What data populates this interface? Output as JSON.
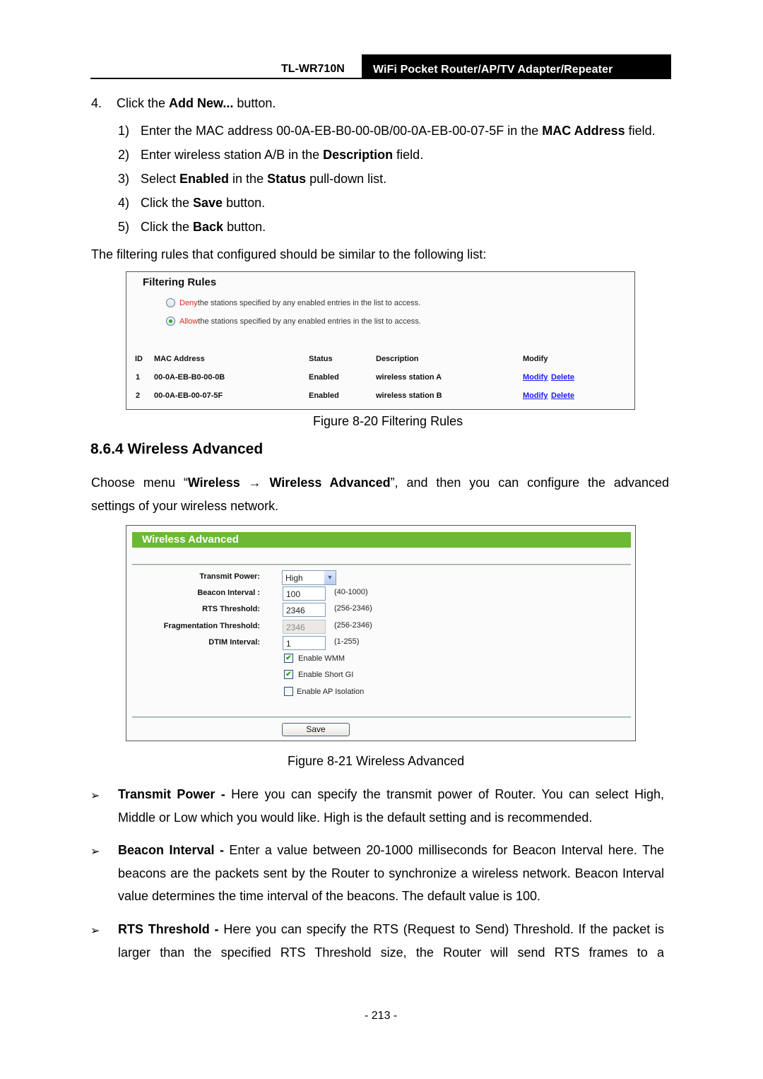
{
  "header": {
    "model": "TL-WR710N",
    "product": "WiFi  Pocket  Router/AP/TV  Adapter/Repeater"
  },
  "steps": {
    "step4": {
      "num": "4.",
      "pre": "Click the ",
      "bold": "Add New...",
      "post": " button."
    },
    "substeps": [
      {
        "num": "1)",
        "parts": [
          "Enter the MAC address 00-0A-EB-B0-00-0B/00-0A-EB-00-07-5F in the ",
          "MAC Address",
          " field."
        ]
      },
      {
        "num": "2)",
        "parts": [
          "Enter wireless station A/B in the ",
          "Description",
          " field."
        ]
      },
      {
        "num": "3)",
        "parts": [
          "Select ",
          "Enabled",
          " in the ",
          "Status",
          " pull-down list."
        ]
      },
      {
        "num": "4)",
        "parts": [
          "Click the ",
          "Save",
          " button."
        ]
      },
      {
        "num": "5)",
        "parts": [
          "Click the ",
          "Back",
          " button."
        ]
      }
    ],
    "intro": "The filtering rules that configured should be similar to the following list:"
  },
  "figure1": {
    "title": "Filtering Rules",
    "options": [
      {
        "keyword": "Deny",
        "text": " the stations specified by any enabled entries in the list to access.",
        "selected": false
      },
      {
        "keyword": "Allow",
        "text": " the stations specified by any enabled entries in the list to access.",
        "selected": true
      }
    ],
    "columns": [
      "ID",
      "MAC Address",
      "Status",
      "Description",
      "Modify"
    ],
    "rows": [
      {
        "id": "1",
        "mac": "00-0A-EB-B0-00-0B",
        "status": "Enabled",
        "description": "wireless station A",
        "modify": "Modify",
        "delete": "Delete"
      },
      {
        "id": "2",
        "mac": "00-0A-EB-00-07-5F",
        "status": "Enabled",
        "description": "wireless station B",
        "modify": "Modify",
        "delete": "Delete"
      }
    ],
    "caption": "Figure 8-20 Filtering Rules"
  },
  "section": {
    "heading": "8.6.4   Wireless Advanced",
    "intro_parts": [
      "Choose  menu  “",
      "Wireless  →  Wireless  Advanced",
      "”,  and  then  you  can  configure  the  advanced"
    ],
    "intro_line2": "settings of your wireless network."
  },
  "figure2": {
    "title": "Wireless Advanced",
    "fields": {
      "transmit_power": {
        "label": "Transmit Power:",
        "value": "High"
      },
      "beacon_interval": {
        "label": "Beacon Interval :",
        "value": "100",
        "range": "(40-1000)"
      },
      "rts_threshold": {
        "label": "RTS Threshold:",
        "value": "2346",
        "range": "(256-2346)"
      },
      "fragmentation_threshold": {
        "label": "Fragmentation Threshold:",
        "value": "2346",
        "range": "(256-2346)"
      },
      "dtim_interval": {
        "label": "DTIM Interval:",
        "value": "1",
        "range": "(1-255)"
      }
    },
    "checkboxes": [
      {
        "label": "Enable WMM",
        "checked": true
      },
      {
        "label": "Enable Short GI",
        "checked": true
      },
      {
        "label": "Enable AP Isolation",
        "checked": false
      }
    ],
    "save_label": "Save",
    "caption": "Figure 8-21 Wireless Advanced"
  },
  "bullets": [
    {
      "term": "Transmit Power -",
      "text": " Here you can specify the transmit power of Router. You can select High, Middle or Low which you would like. High is the default setting and is recommended."
    },
    {
      "term": "Beacon Interval -",
      "text": " Enter a value between 20-1000 milliseconds for Beacon Interval here. The beacons are the packets sent by the Router to synchronize a wireless network. Beacon Interval value determines the time interval of the beacons. The default value is 100."
    },
    {
      "term": "RTS Threshold -",
      "text": " Here you can specify the RTS (Request to Send) Threshold. If the packet is larger than the specified RTS Threshold size, the Router will send RTS frames to a"
    }
  ],
  "bullet_glyph": "➢",
  "page_number": "- 213 -"
}
